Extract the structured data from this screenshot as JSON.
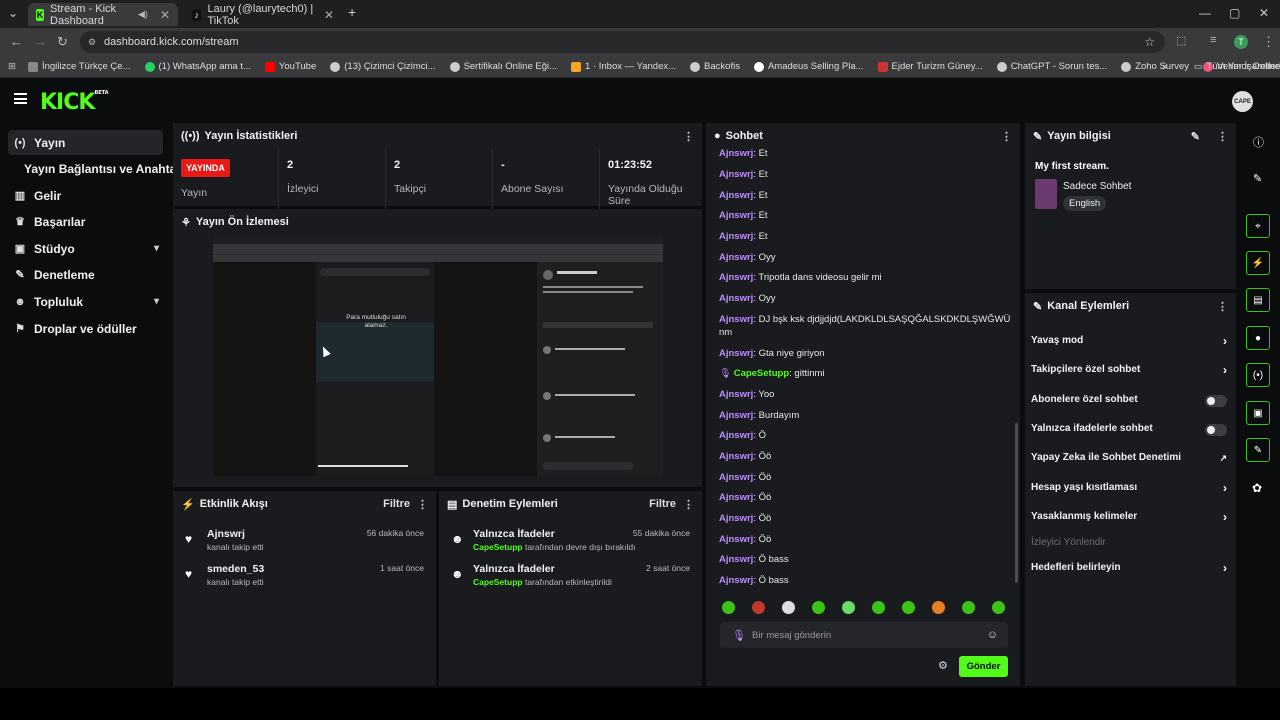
{
  "browser": {
    "tabs": [
      {
        "title": "Stream - Kick Dashboard"
      },
      {
        "title": "Laury (@laurytech0) | TikTok"
      }
    ],
    "url": "dashboard.kick.com/stream",
    "bookmarks": [
      "İngilizce Türkçe Çe...",
      "(1) WhatsApp ama t...",
      "YouTube",
      "(13) Çizimci Çizimci...",
      "Sertifikalı Online Eği...",
      "1 · Inbox — Yandex...",
      "Backofis",
      "Amadeus Selling Pla...",
      "Ejder Turizm Güney...",
      "ChatGPT - Sorun tes...",
      "Zoho Survey",
      "Verimor Online İşle..."
    ],
    "all_bookmarks": "Tüm Yer İşaretleri"
  },
  "logo": {
    "text": "KICK",
    "badge": "BETA"
  },
  "avatar": "CAPE",
  "sidebar": {
    "items": [
      {
        "label": "Yayın"
      },
      {
        "label": "Yayın Bağlantısı ve Anahtarı"
      },
      {
        "label": "Gelir"
      },
      {
        "label": "Başarılar"
      },
      {
        "label": "Stüdyo"
      },
      {
        "label": "Denetleme"
      },
      {
        "label": "Topluluk"
      },
      {
        "label": "Droplar ve ödüller"
      }
    ]
  },
  "stats": {
    "title": "Yayın İstatistikleri",
    "live_badge": "YAYINDA",
    "live_label": "Yayın",
    "viewers_value": "2",
    "viewers_label": "İzleyici",
    "followers_value": "2",
    "followers_label": "Takipçi",
    "subs_value": "-",
    "subs_label": "Abone Sayısı",
    "uptime_value": "01:23:52",
    "uptime_label": "Yayında Olduğu Süre"
  },
  "preview": {
    "title": "Yayın Ön İzlemesi",
    "overlay_text": "Para mutluluğu satın alamaz."
  },
  "activity": {
    "title": "Etkinlik Akışı",
    "filter": "Filtre",
    "items": [
      {
        "name": "Ajnswrj",
        "sub": "kanalı takip etti",
        "time": "56 dakika önce"
      },
      {
        "name": "smeden_53",
        "sub": "kanalı takip etti",
        "time": "1 saat önce"
      }
    ]
  },
  "moderation": {
    "title": "Denetim Eylemleri",
    "filter": "Filtre",
    "items": [
      {
        "name": "Yalnızca İfadeler",
        "user": "CapeSetupp",
        "sub": " tarafından devre dışı bırakıldı",
        "time": "55 dakika önce"
      },
      {
        "name": "Yalnızca İfadeler",
        "user": "CapeSetupp",
        "sub": " tarafından etkinleştirildi",
        "time": "2 saat önce"
      }
    ]
  },
  "chat": {
    "title": "Sohbet",
    "messages": [
      {
        "user": "Ajnswrj",
        "text": ": Et"
      },
      {
        "user": "Ajnswrj",
        "text": ": Et"
      },
      {
        "user": "Ajnswrj",
        "text": ": Et"
      },
      {
        "user": "Ajnswrj",
        "text": ": Et"
      },
      {
        "user": "Ajnswrj",
        "text": ": Et"
      },
      {
        "user": "Ajnswrj",
        "text": ": Oyy"
      },
      {
        "user": "Ajnswrj",
        "text": ": Tripotla dans videosu gelir mi"
      },
      {
        "user": "Ajnswrj",
        "text": ": Oyy"
      },
      {
        "user": "Ajnswrj",
        "text": ": DJ bşk ksk djdjjdjd(LAKDKLDLSAŞQĞALSKDKDLŞWĞWÜ"
      },
      {
        "user": "",
        "text": "nm"
      },
      {
        "user": "Ajnswrj",
        "text": ": Gta niye giriyon"
      },
      {
        "user": "CapeSetupp",
        "text": ": gittinmi"
      },
      {
        "user": "Ajnswrj",
        "text": ": Yoo"
      },
      {
        "user": "Ajnswrj",
        "text": ": Burdayım"
      },
      {
        "user": "Ajnswrj",
        "text": ": Ö"
      },
      {
        "user": "Ajnswrj",
        "text": ": Öö"
      },
      {
        "user": "Ajnswrj",
        "text": ": Öö"
      },
      {
        "user": "Ajnswrj",
        "text": ": Öö"
      },
      {
        "user": "Ajnswrj",
        "text": ": Öö"
      },
      {
        "user": "Ajnswrj",
        "text": ": Öö"
      },
      {
        "user": "Ajnswrj",
        "text": ": Ö bass"
      },
      {
        "user": "Ajnswrj",
        "text": ": Ö bass"
      }
    ],
    "placeholder": "Bir mesaj gönderin",
    "send": "Gönder"
  },
  "stream_info": {
    "title": "Yayın bilgisi",
    "stream_title": "My first stream.",
    "category": "Sadece Sohbet",
    "language": "English"
  },
  "channel_actions": {
    "title": "Kanal Eylemleri",
    "items": [
      {
        "label": "Yavaş mod"
      },
      {
        "label": "Takipçilere özel sohbet"
      },
      {
        "label": "Abonelere özel sohbet"
      },
      {
        "label": "Yalnızca ifadelerle sohbet"
      },
      {
        "label": "Yapay Zeka ile Sohbet Denetimi"
      },
      {
        "label": "Hesap yaşı kısıtlaması"
      },
      {
        "label": "Yasaklanmış kelimeler"
      },
      {
        "label": "İzleyici Yönlendir"
      },
      {
        "label": "Hedefleri belirleyin"
      }
    ]
  },
  "colors": {
    "accent": "#53fc18",
    "username": "#bd8cff",
    "live": "#e91916"
  }
}
